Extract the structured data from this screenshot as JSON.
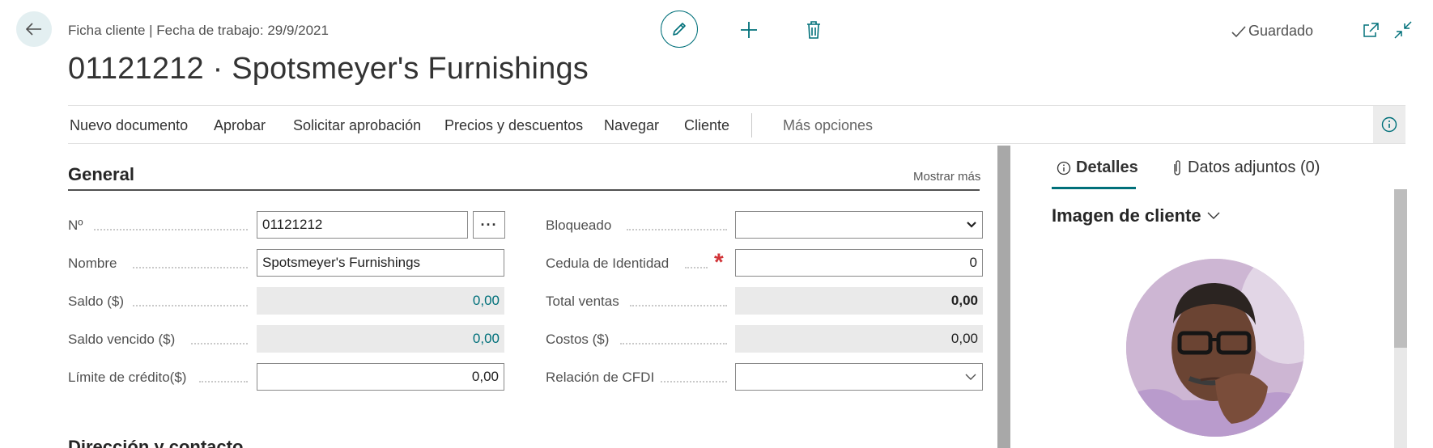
{
  "header": {
    "caption": "Ficha cliente | Fecha de trabajo: 29/9/2021",
    "title": "01121212 · Spotsmeyer's Furnishings",
    "status": "Guardado"
  },
  "actions": {
    "items": [
      "Nuevo documento",
      "Aprobar",
      "Solicitar aprobación",
      "Precios y descuentos",
      "Navegar",
      "Cliente"
    ],
    "more": "Más opciones"
  },
  "general": {
    "title": "General",
    "show_more": "Mostrar más",
    "left": [
      {
        "label": "Nº",
        "value": "01121212"
      },
      {
        "label": "Nombre",
        "value": "Spotsmeyer's Furnishings"
      },
      {
        "label": "Saldo ($)",
        "value": "0,00"
      },
      {
        "label": "Saldo vencido ($)",
        "value": "0,00"
      },
      {
        "label": "Límite de crédito($)",
        "value": "0,00"
      }
    ],
    "right": [
      {
        "label": "Bloqueado",
        "value": ""
      },
      {
        "label": "Cedula de Identidad",
        "value": "0"
      },
      {
        "label": "Total ventas",
        "value": "0,00"
      },
      {
        "label": "Costos ($)",
        "value": "0,00"
      },
      {
        "label": "Relación de CFDI",
        "value": ""
      }
    ],
    "next_section_title": "Dirección y contacto"
  },
  "factbox": {
    "tabs": [
      "Detalles",
      "Datos adjuntos (0)"
    ],
    "picture_title": "Imagen de cliente"
  },
  "colors": {
    "accent": "#00707a",
    "required": "#d13438",
    "readonly_bg": "#eaeaea"
  },
  "icons": [
    "back-arrow-icon",
    "pencil-icon",
    "plus-icon",
    "trash-icon",
    "checkmark-icon",
    "open-new-window-icon",
    "collapse-icon",
    "info-icon",
    "paperclip-icon",
    "chevron-down-icon"
  ]
}
